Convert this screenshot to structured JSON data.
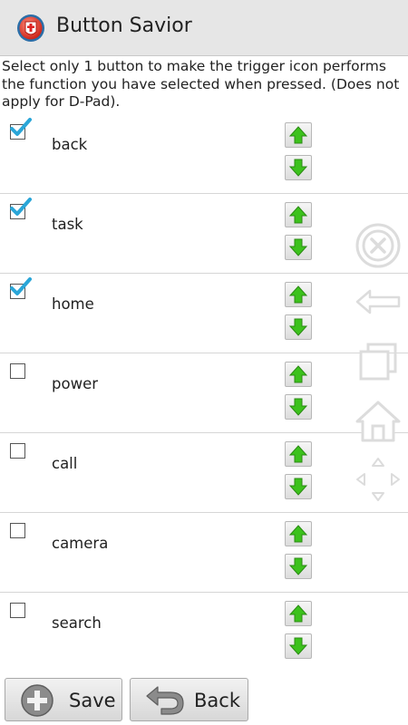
{
  "app": {
    "title": "Button Savior",
    "icon": "button-savior-app-icon"
  },
  "instructions": "Select only 1 button to make the trigger icon performs the function you have selected when pressed. (Does not apply for D-Pad).",
  "buttons": [
    {
      "label": "back",
      "checked": true
    },
    {
      "label": "task",
      "checked": true
    },
    {
      "label": "home",
      "checked": true
    },
    {
      "label": "power",
      "checked": false
    },
    {
      "label": "call",
      "checked": false
    },
    {
      "label": "camera",
      "checked": false
    },
    {
      "label": "search",
      "checked": false
    }
  ],
  "overlay_icons": [
    "close-circle-icon",
    "back-arrow-icon",
    "task-windows-icon",
    "home-icon",
    "dpad-icon"
  ],
  "footer": {
    "save_label": "Save",
    "back_label": "Back"
  },
  "colors": {
    "check": "#2aa6d8",
    "arrow": "#3cc21c",
    "appbar": "#e6e6e6"
  }
}
